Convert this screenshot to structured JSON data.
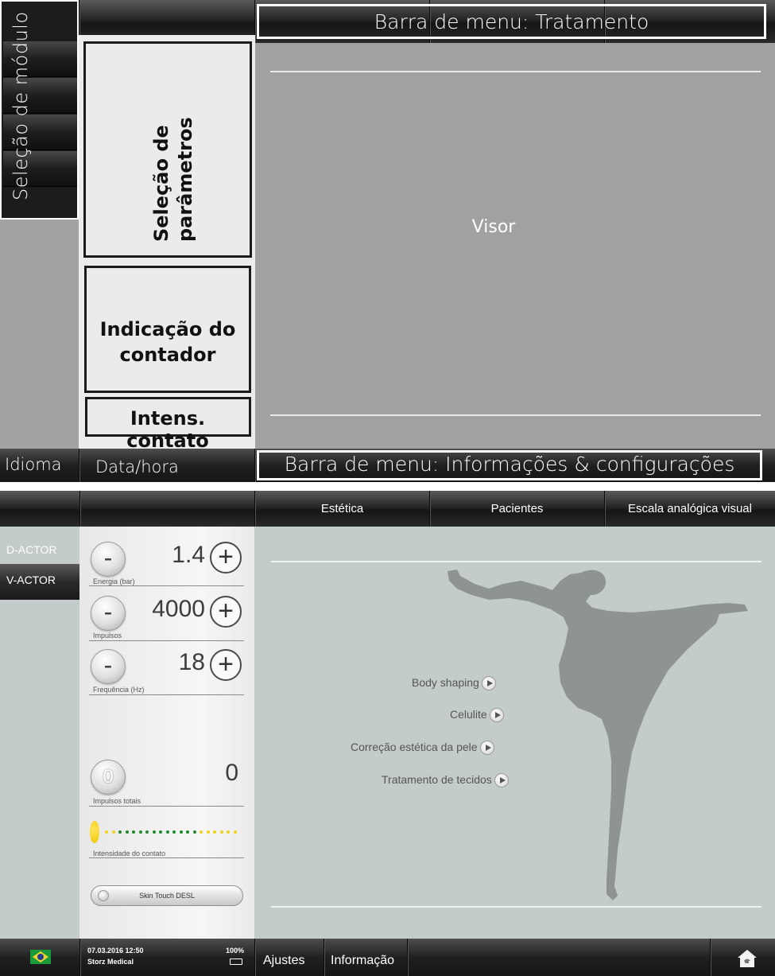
{
  "top_screen": {
    "sidebar_label": "Seleção de módulo",
    "header_label": "Barra de menu: Tratamento",
    "parameter_label_line1": "Seleção de",
    "parameter_label_line2": "parâmetros",
    "counter_label_line1": "Indicação do",
    "counter_label_line2": "contador",
    "contact_label": "Intens. contato",
    "display_label": "Visor",
    "footer": {
      "language": "Idioma",
      "datetime": "Data/hora",
      "info_bar": "Barra de menu: Informações & configurações"
    }
  },
  "bottom_screen": {
    "top_menu": [
      "Estética",
      "Pacientes",
      "Escala analógica visual"
    ],
    "sidebar_items": [
      {
        "label": "D-ACTOR",
        "active": false
      },
      {
        "label": "V-ACTOR",
        "active": true
      }
    ],
    "parameters": [
      {
        "value": "1.4",
        "label": "Energia (bar)"
      },
      {
        "value": "4000",
        "label": "Impulsos"
      },
      {
        "value": "18",
        "label": "Frequência (Hz)"
      }
    ],
    "total": {
      "reset_symbol": "0",
      "value": "0",
      "label": "Impulsos totais"
    },
    "contact": {
      "label": "Intensidade do contato",
      "level": 0.72
    },
    "skin_button": "Skin Touch DESL",
    "menu_links": [
      "Body shaping",
      "Celulite",
      "Correção estética da pele",
      "Tratamento de tecidos"
    ],
    "footer": {
      "datetime": "07.03.2016 12:50",
      "company": "Storz Medical",
      "battery": "100%",
      "settings": "Ajustes",
      "info": "Informação"
    }
  },
  "colors": {
    "dark_bar": "#1a1a1a",
    "display_top": "#a1a1a1",
    "display_bottom": "#c3ccca",
    "dot_green": "#1f8a2c",
    "dot_yellow": "#f2d21b"
  }
}
